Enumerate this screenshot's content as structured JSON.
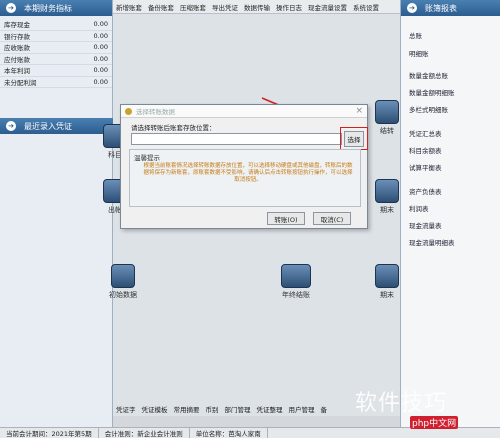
{
  "menubar": [
    "新增账套",
    "备份账套",
    "压缩账套",
    "导出凭证",
    "数据传输",
    "操作日志",
    "现金流量设置",
    "系统设置"
  ],
  "left": {
    "header": "本期财务指标",
    "rows": [
      {
        "label": "库存现金",
        "value": "0.00"
      },
      {
        "label": "银行存款",
        "value": "0.00"
      },
      {
        "label": "应收账款",
        "value": "0.00"
      },
      {
        "label": "应付账款",
        "value": "0.00"
      },
      {
        "label": "本年利润",
        "value": "0.00"
      },
      {
        "label": "未分配利润",
        "value": "0.00"
      }
    ],
    "recent_header": "最近录入凭证"
  },
  "right": {
    "header": "账簿报表",
    "items": [
      "总账",
      "明细账",
      "数量金额总账",
      "数量金额明细账",
      "多栏式明细账",
      "凭证汇总表",
      "科目余额表",
      "试算平衡表",
      "资产负债表",
      "利润表",
      "现金流量表",
      "现金流量明细表"
    ]
  },
  "workspace": {
    "icons": [
      "科目",
      "结转",
      "出帐",
      "期末",
      "初始数据",
      "年终结账",
      "期末"
    ]
  },
  "bottom_menu": [
    "凭证字",
    "凭证模板",
    "常用摘要",
    "币别",
    "部门管理",
    "凭证整理",
    "用户管理",
    "备"
  ],
  "status": [
    "当前会计期间：2021年第5期",
    "会计准则：新企业会计准则",
    "单位名称：芭淘人家南"
  ],
  "dialog": {
    "title": "选择转账数据",
    "prompt": "请选择转账后账套存放位置：",
    "path_value": "",
    "browse": "选择",
    "tip_title": "温馨提示",
    "tip_text": "根据当前账套情况选择转账数据存放位置，可以选择移动硬盘或其他磁盘，转账后的数据将保存为新账套，原账套数据不受影响，请确认后点击转账按钮执行操作，可以选择取消按钮。",
    "ok": "转账(O)",
    "cancel": "取消(C)"
  },
  "watermark": {
    "text": "软件技巧",
    "sub": "php中文网"
  }
}
